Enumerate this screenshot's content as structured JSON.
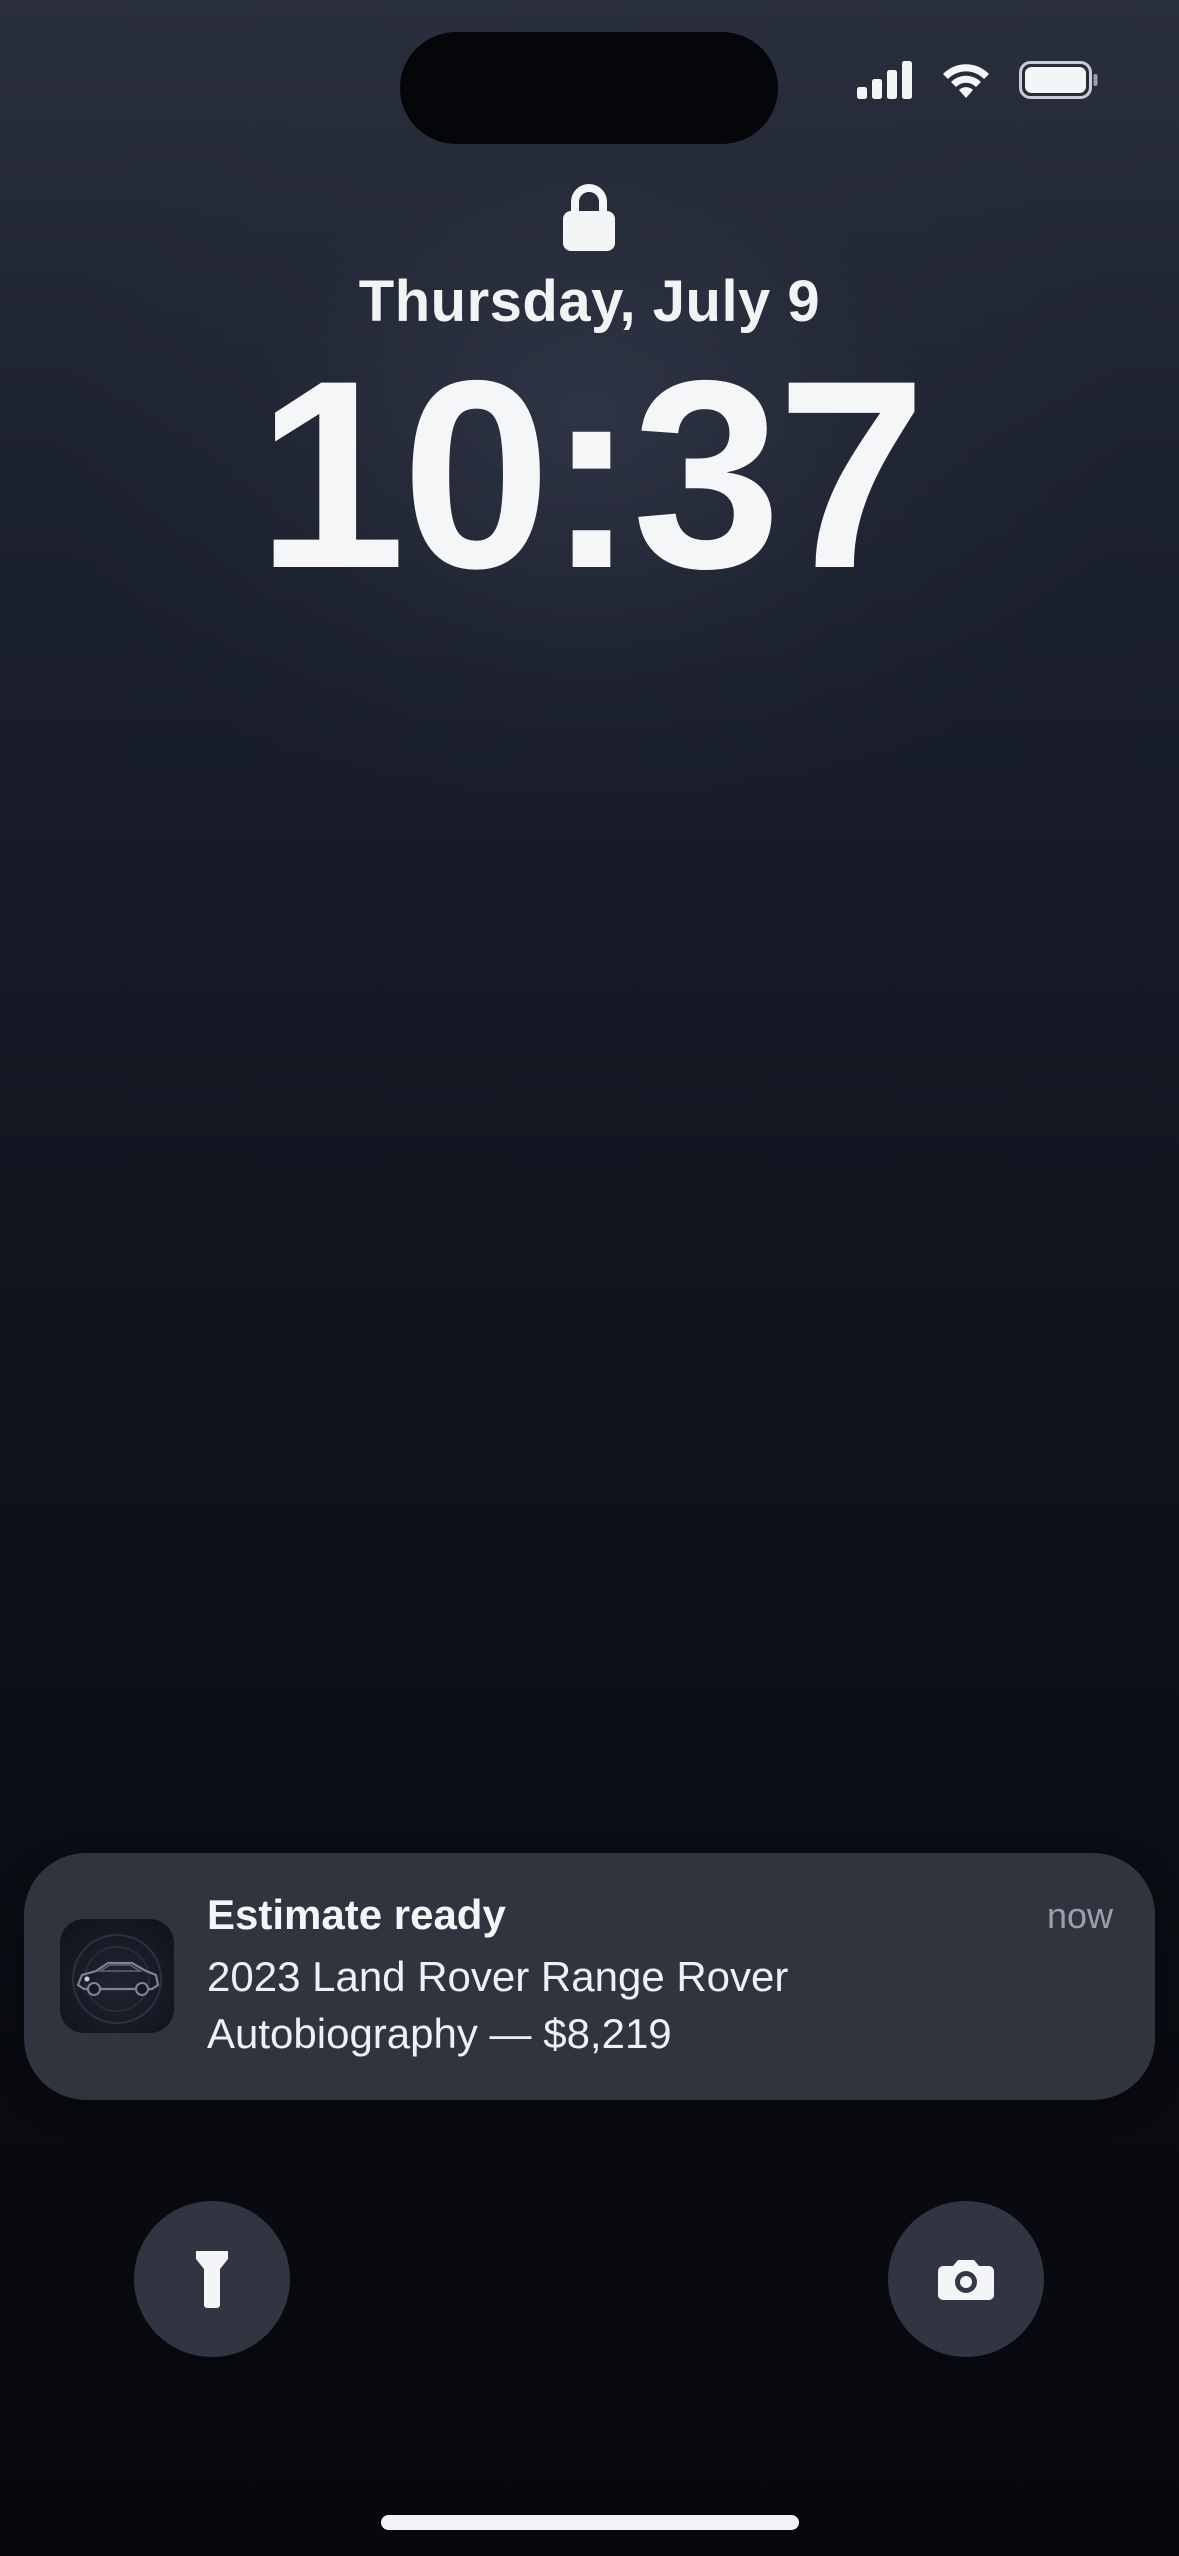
{
  "status_bar": {
    "signal_icon": "cellular-signal-icon",
    "wifi_icon": "wifi-icon",
    "battery_icon": "battery-icon",
    "battery_level": 1.0
  },
  "lock_screen": {
    "lock_icon": "lock-icon",
    "date": "Thursday, July 9",
    "time": "10:37"
  },
  "notification": {
    "app_icon": "car-app-icon",
    "title": "Estimate ready",
    "time": "now",
    "body_line1": "2023 Land Rover Range Rover",
    "body_line2": "Autobiography — $8,219"
  },
  "quick_actions": {
    "left": "flashlight-icon",
    "right": "camera-icon"
  },
  "colors": {
    "background_top": "#2a2f3d",
    "background_bottom": "#07080d",
    "notification_bg": "#323642",
    "text_primary": "#f4f5f7",
    "text_secondary": "#9aa0ab"
  }
}
